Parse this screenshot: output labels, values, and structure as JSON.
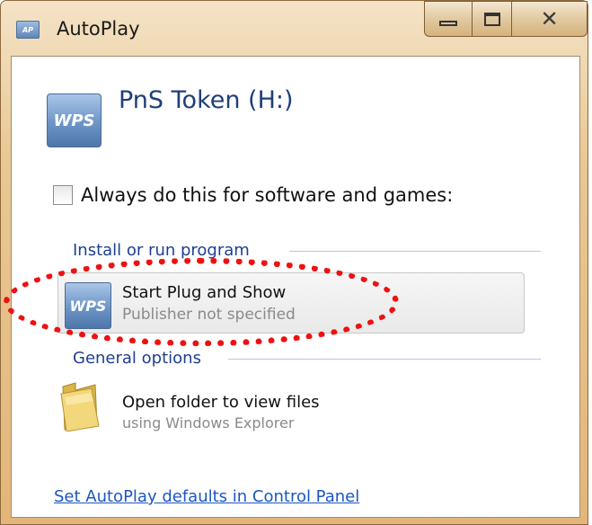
{
  "window": {
    "title": "AutoPlay",
    "icon": "autoplay-window-icon",
    "controls": {
      "minimize_icon": "minimize-icon",
      "maximize_icon": "maximize-icon",
      "close_glyph": "✕"
    }
  },
  "drive": {
    "icon_text": "WPS",
    "title": "PnS Token (H:)"
  },
  "always_checkbox": {
    "label": "Always do this for software and games:",
    "checked": false
  },
  "install_group": {
    "header": "Install or run program",
    "options": [
      {
        "icon_text": "WPS",
        "title": "Start Plug and Show",
        "subtitle": "Publisher not specified"
      }
    ]
  },
  "general_group": {
    "header": "General options",
    "options": [
      {
        "icon": "folder-icon",
        "title": "Open folder to view files",
        "subtitle": "using Windows Explorer"
      }
    ]
  },
  "footer_link": "Set AutoPlay defaults in Control Panel",
  "colors": {
    "frame": "#e3b57a",
    "link": "#1b56c4",
    "group_header": "#1f3f8f",
    "annotation": "#ee1111"
  }
}
